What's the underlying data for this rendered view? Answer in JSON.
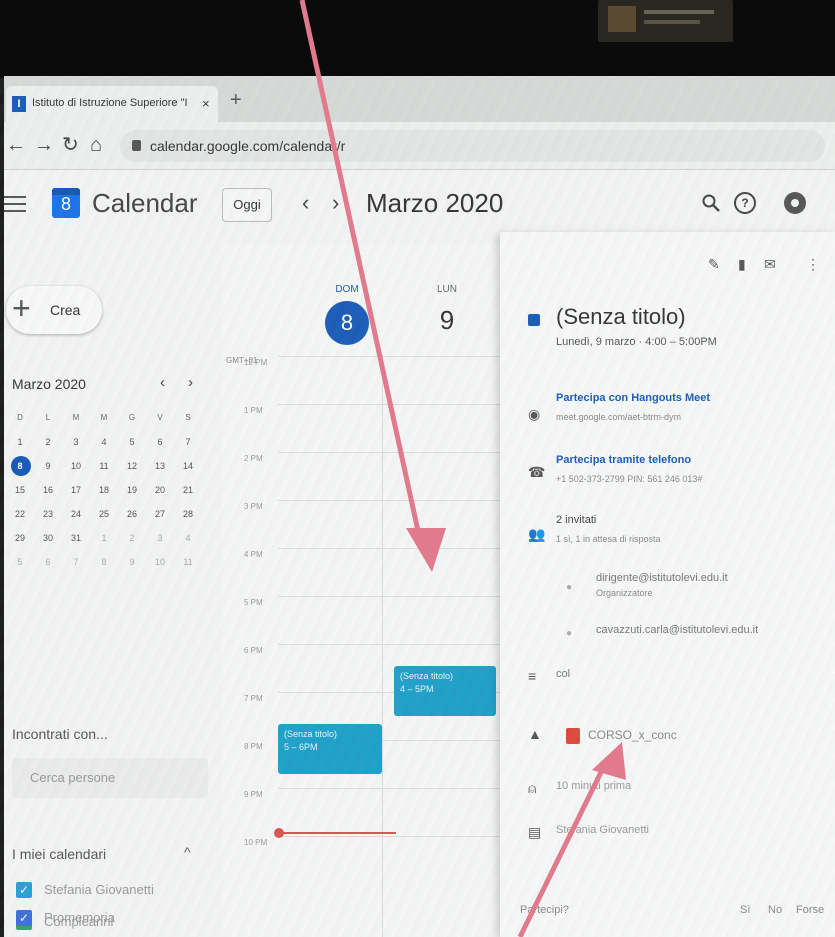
{
  "browser": {
    "tab_title": "Istituto di Istruzione Superiore \"I",
    "tab_close": "×",
    "new_tab": "+",
    "url": "calendar.google.com/calendar/r"
  },
  "header": {
    "app_name": "Calendar",
    "logo_day": "8",
    "today_button": "Oggi",
    "prev": "‹",
    "next": "›",
    "month_title": "Marzo 2020",
    "help": "?"
  },
  "sidebar": {
    "create_label": "Crea",
    "mini_calendar": {
      "title": "Marzo 2020",
      "prev": "‹",
      "next": "›",
      "weekdays": [
        "D",
        "L",
        "M",
        "M",
        "G",
        "V",
        "S"
      ],
      "weeks": [
        [
          "1",
          "2",
          "3",
          "4",
          "5",
          "6",
          "7"
        ],
        [
          "8",
          "9",
          "10",
          "11",
          "12",
          "13",
          "14"
        ],
        [
          "15",
          "16",
          "17",
          "18",
          "19",
          "20",
          "21"
        ],
        [
          "22",
          "23",
          "24",
          "25",
          "26",
          "27",
          "28"
        ],
        [
          "29",
          "30",
          "31",
          "1",
          "2",
          "3",
          "4"
        ],
        [
          "5",
          "6",
          "7",
          "8",
          "9",
          "10",
          "11"
        ]
      ],
      "today": "8"
    },
    "meet_with": "Incontrati con...",
    "search_people_placeholder": "Cerca persone",
    "my_calendars": "I miei calendari",
    "chevron": "^",
    "calendars": [
      {
        "label": "Stefania Giovanetti",
        "color": "#2a9fd6"
      },
      {
        "label": "Compleanni",
        "color": "#33a372"
      },
      {
        "label": "Promemoria",
        "color": "#3f6fd8"
      }
    ]
  },
  "grid": {
    "days": [
      {
        "name": "DOM",
        "number": "8"
      },
      {
        "name": "LUN",
        "number": "9"
      }
    ],
    "timezone": "GMT+01",
    "hours": [
      "12 PM",
      "1 PM",
      "2 PM",
      "3 PM",
      "4 PM",
      "5 PM",
      "6 PM",
      "7 PM",
      "8 PM",
      "9 PM",
      "10 PM"
    ],
    "events": [
      {
        "title": "(Senza titolo)",
        "time": "4 – 5PM"
      },
      {
        "title": "(Senza titolo)",
        "time": "5 – 6PM"
      }
    ]
  },
  "panel": {
    "title": "(Senza titolo)",
    "when": "Lunedì, 9 marzo  ·  4:00 – 5:00PM",
    "meet_link": "Partecipa con Hangouts Meet",
    "meet_url": "meet.google.com/aet-btrm-dym",
    "phone_link": "Partecipa tramite telefono",
    "phone_detail": "+1 502-373-2799 PIN: 561 246 013#",
    "guests_count": "2 invitati",
    "guests_status": "1 sì, 1 in attesa di risposta",
    "guest1": "dirigente@istitutolevi.edu.it",
    "guest1_role": "Organizzatore",
    "guest2": "cavazzuti.carla@istitutolevi.edu.it",
    "description": "col",
    "attachment": "CORSO_x_conc",
    "reminder": "10 minuti prima",
    "calendar": "Stefania Giovanetti",
    "rsvp_label": "Partecipi?",
    "rsvp_yes": "Sì",
    "rsvp_no": "No",
    "rsvp_maybe": "Forse"
  },
  "colors": {
    "accent": "#1a5bb8",
    "event": "#1ea0c9",
    "arrow": "#e07a8c",
    "now_line": "#d9534f"
  }
}
